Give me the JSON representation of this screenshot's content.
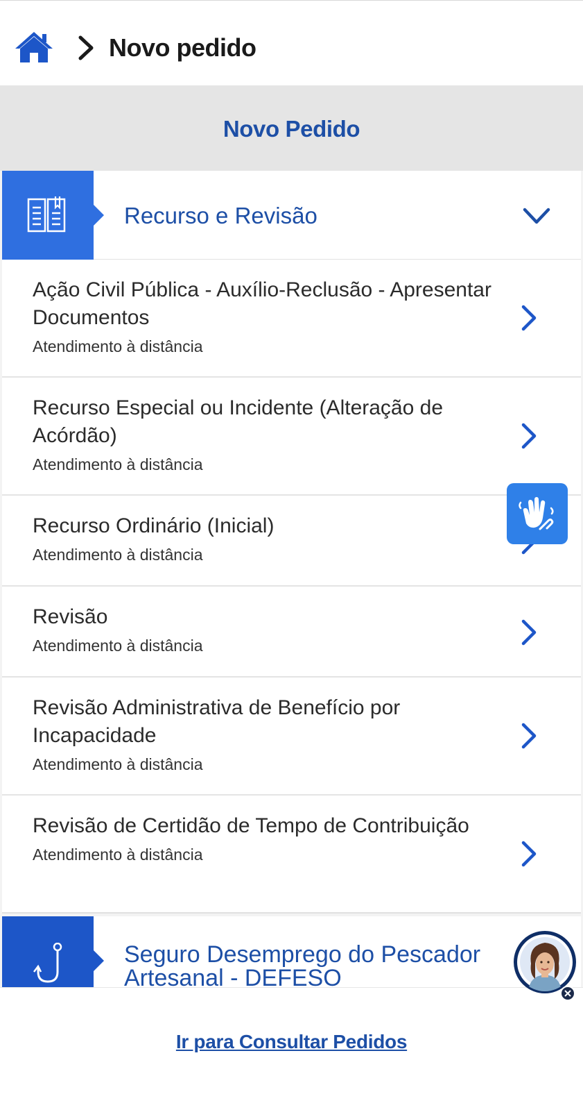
{
  "breadcrumb": {
    "home_icon": "home-icon",
    "separator_icon": "chevron-right-icon",
    "current": "Novo pedido"
  },
  "section_title": "Novo Pedido",
  "category": {
    "label": "Recurso e Revisão",
    "icon": "book-icon",
    "toggle_icon": "chevron-down-icon",
    "expanded": true
  },
  "items": [
    {
      "title": "Ação Civil Pública - Auxílio-Reclusão - Apresentar Documentos",
      "subtitle": "Atendimento à distância"
    },
    {
      "title": "Recurso Especial ou Incidente (Alteração de Acórdão)",
      "subtitle": "Atendimento à distância"
    },
    {
      "title": "Recurso Ordinário (Inicial)",
      "subtitle": "Atendimento à distância"
    },
    {
      "title": "Revisão",
      "subtitle": "Atendimento à distância"
    },
    {
      "title": "Revisão Administrativa de Benefício por Incapacidade",
      "subtitle": "Atendimento à distância"
    },
    {
      "title": "Revisão de Certidão de Tempo de Contribuição",
      "subtitle": "Atendimento à distância"
    }
  ],
  "next_category": {
    "label": "Seguro Desemprego do Pescador Artesanal - DEFESO",
    "icon": "fishing-hook-icon"
  },
  "footer": {
    "link_label": "Ir para Consultar Pedidos"
  },
  "floating": {
    "libras_icon": "sign-language-hands-icon",
    "assistant_icon": "assistant-avatar-icon",
    "close_icon": "close-icon"
  },
  "colors": {
    "primary": "#1d4fa6",
    "accent": "#2f6fe0",
    "band": "#e5e5e5"
  }
}
